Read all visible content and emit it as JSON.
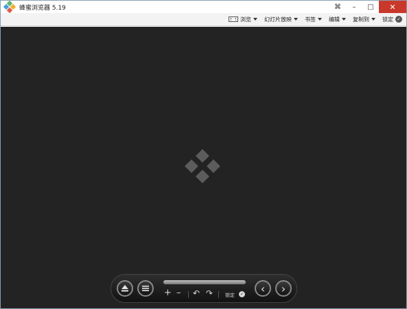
{
  "window": {
    "title": "蜂蜜浏览器 5.19",
    "buttons": {
      "restore_glyph": "⌘",
      "minimize_glyph": "–",
      "maximize_glyph": "□",
      "close_glyph": "✕"
    }
  },
  "menu": {
    "items": [
      {
        "label": "浏览",
        "icon": "browse-icon"
      },
      {
        "label": "幻灯片放映"
      },
      {
        "label": "书签"
      },
      {
        "label": "编辑"
      },
      {
        "label": "复制到"
      }
    ],
    "lock_label": "锁定"
  },
  "controls": {
    "zoom_in": "+",
    "zoom_out": "–",
    "rotate_left": "↶",
    "rotate_right": "↷",
    "lock_label": "锁定",
    "prev": "‹",
    "next": "›"
  },
  "colors": {
    "viewer_bg": "#232323",
    "close_button": "#c8392b"
  }
}
